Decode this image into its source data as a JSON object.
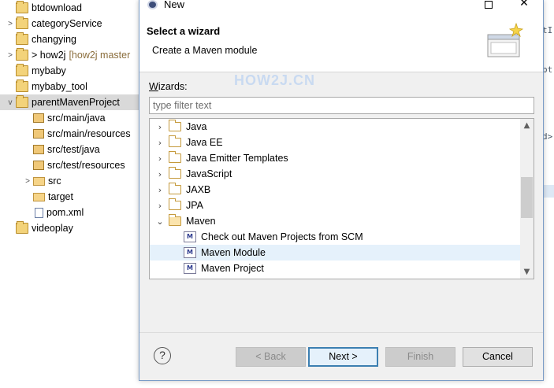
{
  "explorer": {
    "items": [
      {
        "label": "btdownload",
        "icon": "maven-project-icon",
        "chevron": ""
      },
      {
        "label": "categoryService",
        "icon": "maven-project-icon",
        "chevron": ">"
      },
      {
        "label": "changying",
        "icon": "project-icon",
        "chevron": ""
      },
      {
        "label": "> how2j",
        "git": "[how2j master",
        "icon": "git-project-icon",
        "chevron": ">"
      },
      {
        "label": "mybaby",
        "icon": "project-icon",
        "chevron": ""
      },
      {
        "label": "mybaby_tool",
        "icon": "project-icon",
        "chevron": ""
      },
      {
        "label": "parentMavenProject",
        "icon": "maven-project-icon",
        "chevron": "v"
      },
      {
        "label": "src/main/java",
        "icon": "source-folder-icon",
        "chevron": ""
      },
      {
        "label": "src/main/resources",
        "icon": "source-folder-icon",
        "chevron": ""
      },
      {
        "label": "src/test/java",
        "icon": "source-folder-icon",
        "chevron": ""
      },
      {
        "label": "src/test/resources",
        "icon": "source-folder-icon",
        "chevron": ""
      },
      {
        "label": "src",
        "icon": "folder-icon",
        "chevron": ">"
      },
      {
        "label": "target",
        "icon": "folder-icon",
        "chevron": ""
      },
      {
        "label": "pom.xml",
        "icon": "xml-file-icon",
        "chevron": ""
      },
      {
        "label": "videoplay",
        "icon": "project-icon",
        "chevron": ""
      }
    ]
  },
  "editor": {
    "fragments": [
      "tI",
      "pt",
      "d>"
    ]
  },
  "dialog": {
    "title": "New",
    "header_title": "Select a wizard",
    "header_desc": "Create a Maven module",
    "wizards_label_prefix": "W",
    "wizards_label_rest": "izards:",
    "filter_placeholder": "type filter text",
    "watermark": "HOW2J.CN",
    "tree": [
      {
        "label": "Java",
        "type": "category",
        "expanded": false
      },
      {
        "label": "Java EE",
        "type": "category",
        "expanded": false
      },
      {
        "label": "Java Emitter Templates",
        "type": "category",
        "expanded": false
      },
      {
        "label": "JavaScript",
        "type": "category",
        "expanded": false
      },
      {
        "label": "JAXB",
        "type": "category",
        "expanded": false
      },
      {
        "label": "JPA",
        "type": "category",
        "expanded": false
      },
      {
        "label": "Maven",
        "type": "category",
        "expanded": true
      },
      {
        "label": "Check out Maven Projects from SCM",
        "type": "wizard",
        "selected": false
      },
      {
        "label": "Maven Module",
        "type": "wizard",
        "selected": true
      },
      {
        "label": "Maven Project",
        "type": "wizard",
        "selected": false
      }
    ],
    "buttons": {
      "help": "?",
      "back": "< Back",
      "next": "Next >",
      "finish": "Finish",
      "cancel": "Cancel"
    },
    "window_controls": {
      "minimize": "—",
      "close": "✕"
    }
  }
}
